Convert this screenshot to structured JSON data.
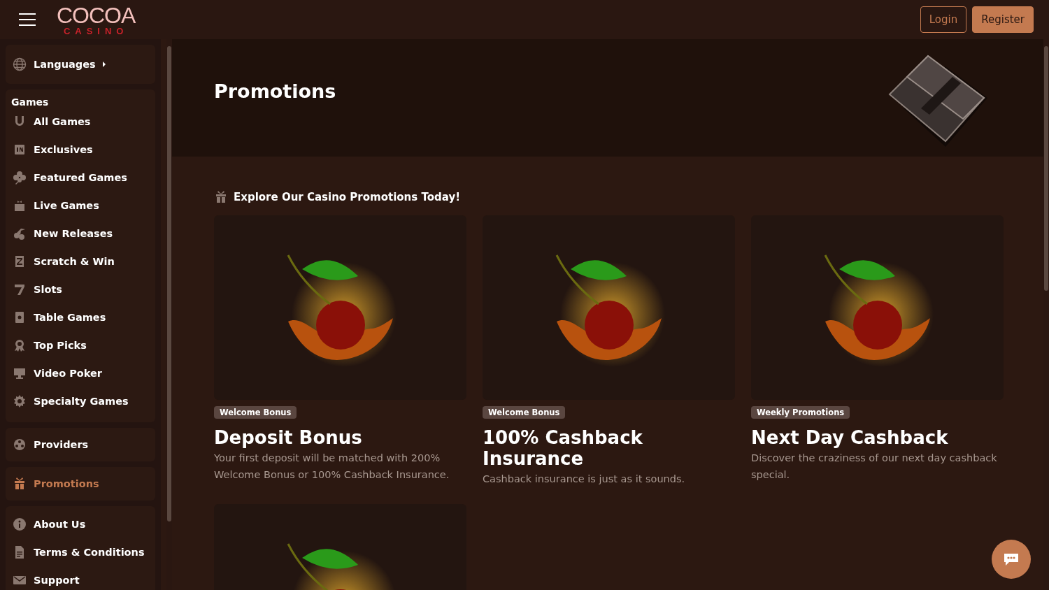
{
  "header": {
    "logo_top": "COCOA",
    "logo_bottom": "CASINO",
    "login": "Login",
    "register": "Register"
  },
  "sidebar": {
    "languages": "Languages",
    "games_heading": "Games",
    "games": [
      {
        "label": "All Games",
        "selected": false
      },
      {
        "label": "Exclusives",
        "selected": false
      },
      {
        "label": "Featured Games",
        "selected": false
      },
      {
        "label": "Live Games",
        "selected": false
      },
      {
        "label": "New Releases",
        "selected": false
      },
      {
        "label": "Scratch & Win",
        "selected": false
      },
      {
        "label": "Slots",
        "selected": false
      },
      {
        "label": "Table Games",
        "selected": false
      },
      {
        "label": "Top Picks",
        "selected": false
      },
      {
        "label": "Video Poker",
        "selected": false
      },
      {
        "label": "Specialty Games",
        "selected": false
      }
    ],
    "sections": [
      {
        "label": "Providers",
        "selected": false
      },
      {
        "label": "Promotions",
        "selected": true
      }
    ],
    "info": [
      {
        "label": "About Us",
        "selected": false
      },
      {
        "label": "Terms & Conditions",
        "selected": false
      },
      {
        "label": "Support",
        "selected": false
      }
    ]
  },
  "hero": {
    "title": "Promotions"
  },
  "section_heading": "Explore Our Casino Promotions Today!",
  "cards": [
    {
      "kind": "full",
      "tag": "Welcome Bonus",
      "title": "Deposit Bonus",
      "description": "Your first deposit will be matched with 200% Welcome Bonus or 100% Cashback Insurance."
    },
    {
      "kind": "full",
      "tag": "Welcome Bonus",
      "title": "100% Cashback Insurance",
      "description": "Cashback insurance is just as it sounds."
    },
    {
      "kind": "full",
      "tag": "Weekly Promotions",
      "title": "Next Day Cashback",
      "description": "Discover the craziness of our next day cashback special."
    },
    {
      "kind": "image_only"
    }
  ]
}
